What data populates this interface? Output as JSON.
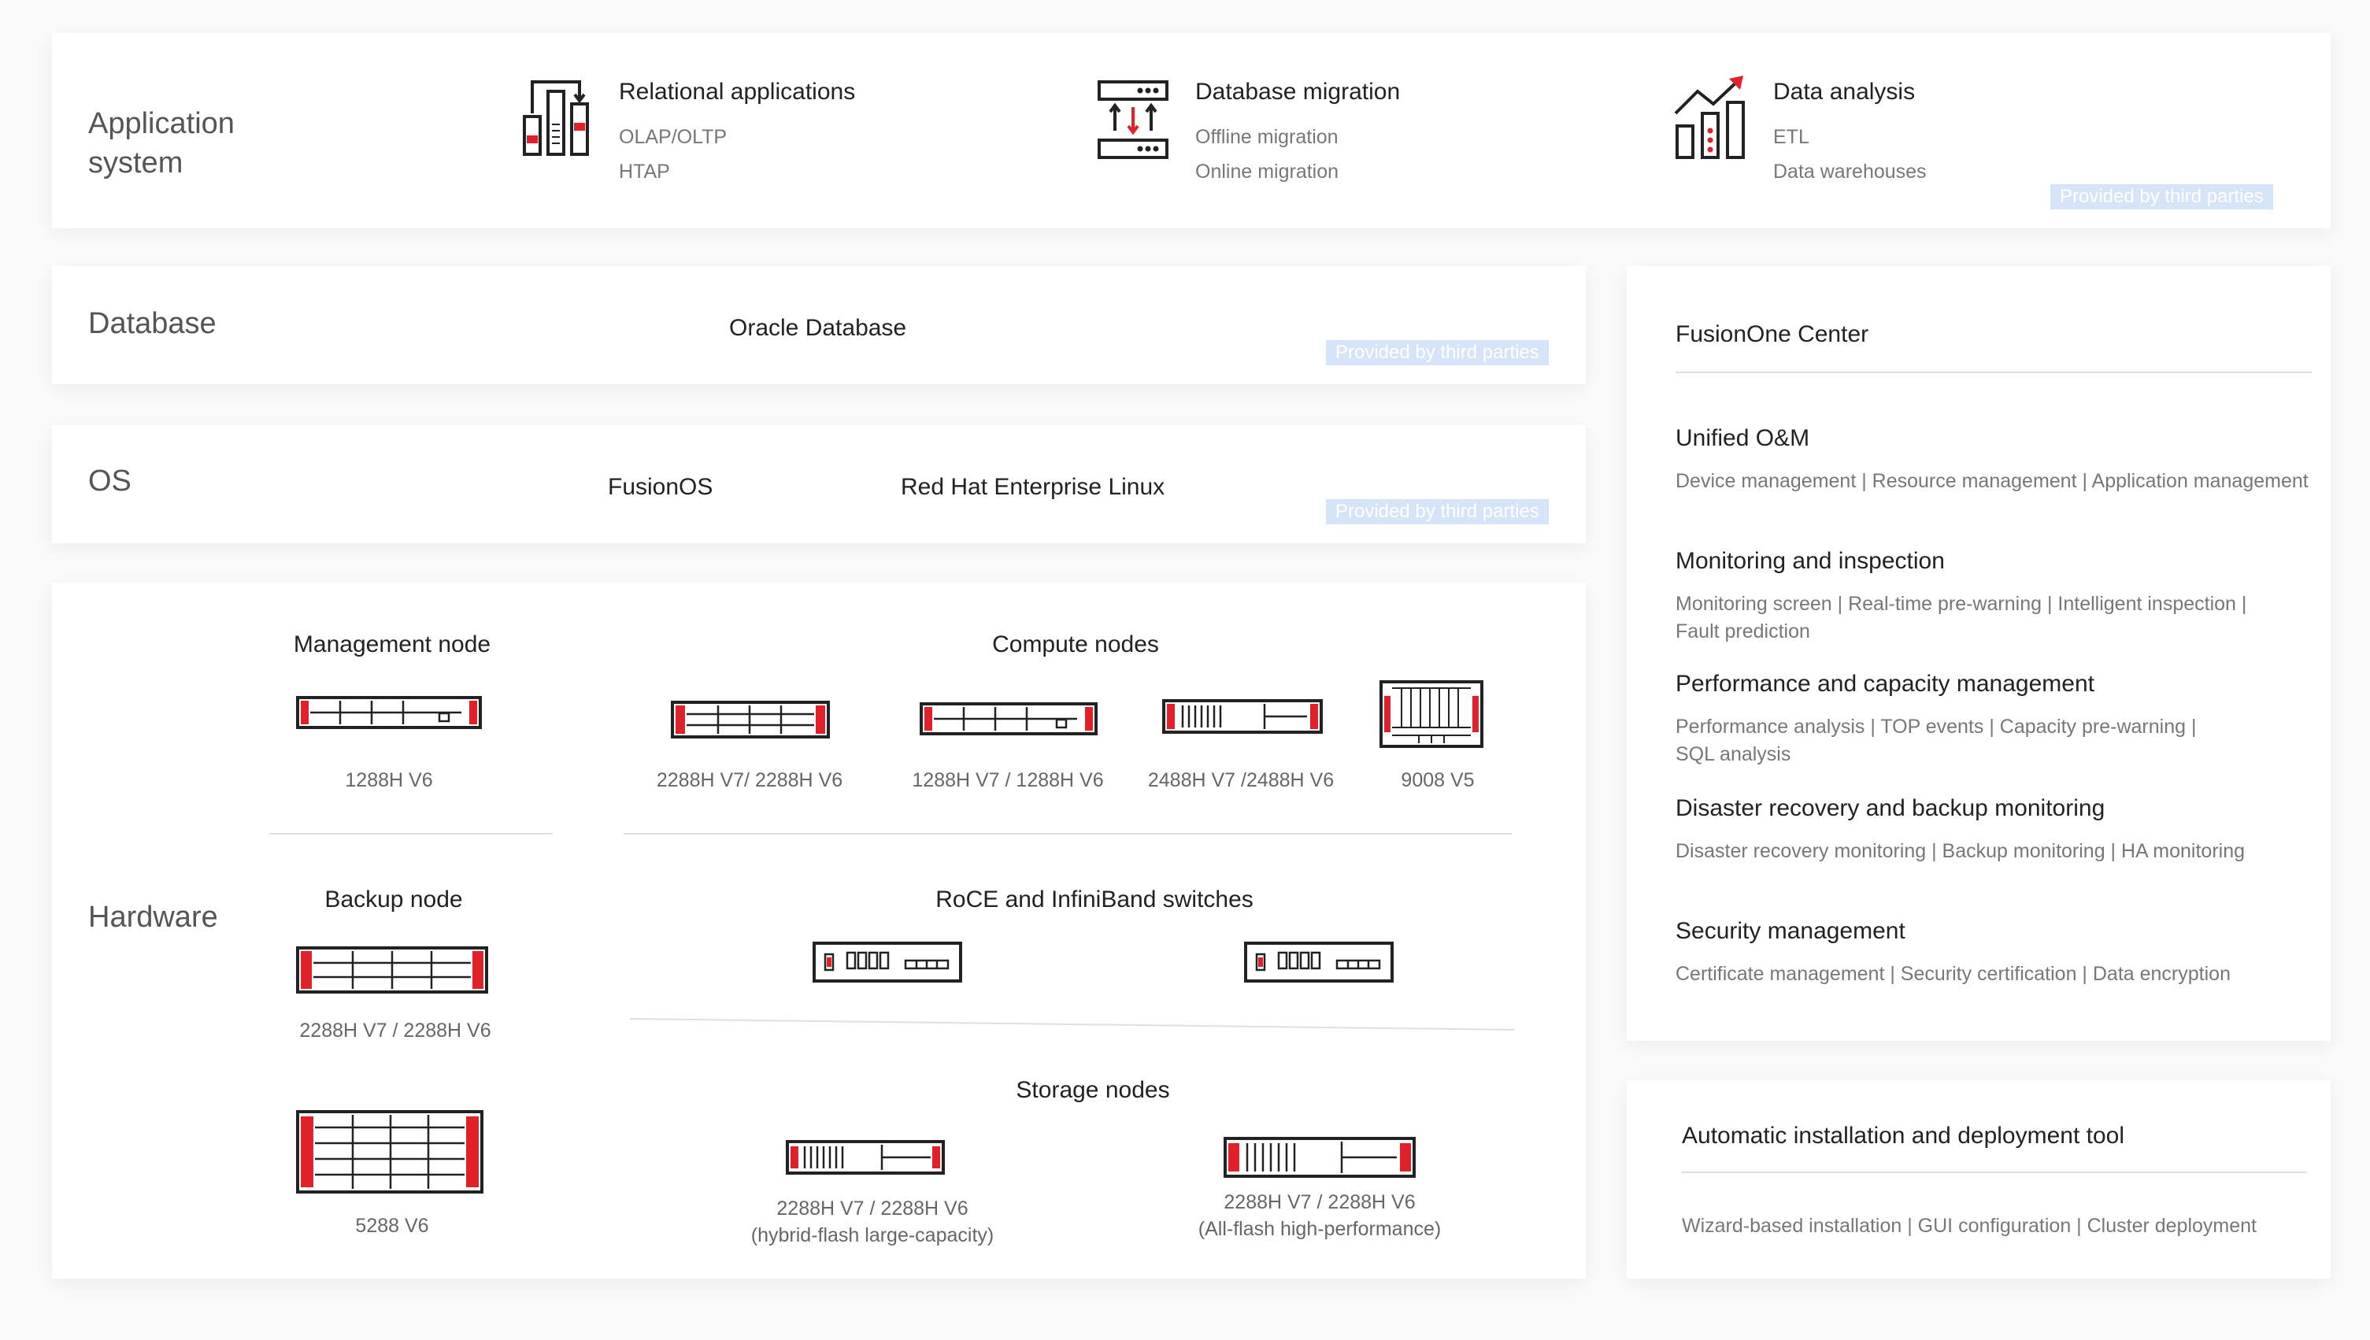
{
  "app_layer": {
    "title": "Application system",
    "groups": [
      {
        "title": "Relational applications",
        "items": [
          "OLAP/OLTP",
          "HTAP"
        ],
        "icon": "relational-apps-icon"
      },
      {
        "title": "Database migration",
        "items": [
          "Offline migration",
          "Online migration"
        ],
        "icon": "migration-icon"
      },
      {
        "title": "Data analysis",
        "items": [
          "ETL",
          "Data warehouses"
        ],
        "icon": "data-analysis-icon"
      }
    ],
    "badge": "Provided by third parties"
  },
  "database_layer": {
    "title": "Database",
    "item": "Oracle Database",
    "badge": "Provided by third parties"
  },
  "os_layer": {
    "title": "OS",
    "items": [
      "FusionOS",
      "Red Hat Enterprise Linux"
    ],
    "badge": "Provided by third parties"
  },
  "hardware_layer": {
    "title": "Hardware",
    "management": {
      "title": "Management node",
      "models": [
        "1288H V6"
      ]
    },
    "compute": {
      "title": "Compute nodes",
      "models": [
        "2288H V7/ 2288H V6",
        "1288H V7 / 1288H V6",
        "2488H V7 /2488H V6",
        "9008 V5"
      ]
    },
    "backup": {
      "title": "Backup node",
      "models": [
        "2288H V7 / 2288H V6",
        "5288 V6"
      ]
    },
    "switches": {
      "title": "RoCE and InfiniBand switches"
    },
    "storage": {
      "title": "Storage nodes",
      "models": [
        {
          "name": "2288H V7 / 2288H V6",
          "note": "(hybrid-flash large-capacity)"
        },
        {
          "name": "2288H V7 / 2288H V6",
          "note": "(All-flash high-performance)"
        }
      ]
    }
  },
  "fusionone": {
    "title": "FusionOne Center",
    "sections": [
      {
        "title": "Unified O&M",
        "desc": "Device management | Resource management | Application management"
      },
      {
        "title": "Monitoring and inspection",
        "desc": "Monitoring screen | Real-time pre-warning | Intelligent inspection | Fault prediction"
      },
      {
        "title": "Performance and capacity management",
        "desc": "Performance analysis | TOP events | Capacity pre-warning | SQL analysis"
      },
      {
        "title": "Disaster recovery and backup monitoring",
        "desc": "Disaster recovery monitoring | Backup monitoring | HA monitoring"
      },
      {
        "title": "Security management",
        "desc": "Certificate management | Security certification | Data encryption"
      }
    ]
  },
  "deploy_tool": {
    "title": "Automatic installation and deployment tool",
    "desc": "Wizard-based installation | GUI configuration | Cluster deployment"
  },
  "colors": {
    "accent": "#e0212a",
    "badge_bg": "#d6e4fa",
    "line": "#222222"
  }
}
